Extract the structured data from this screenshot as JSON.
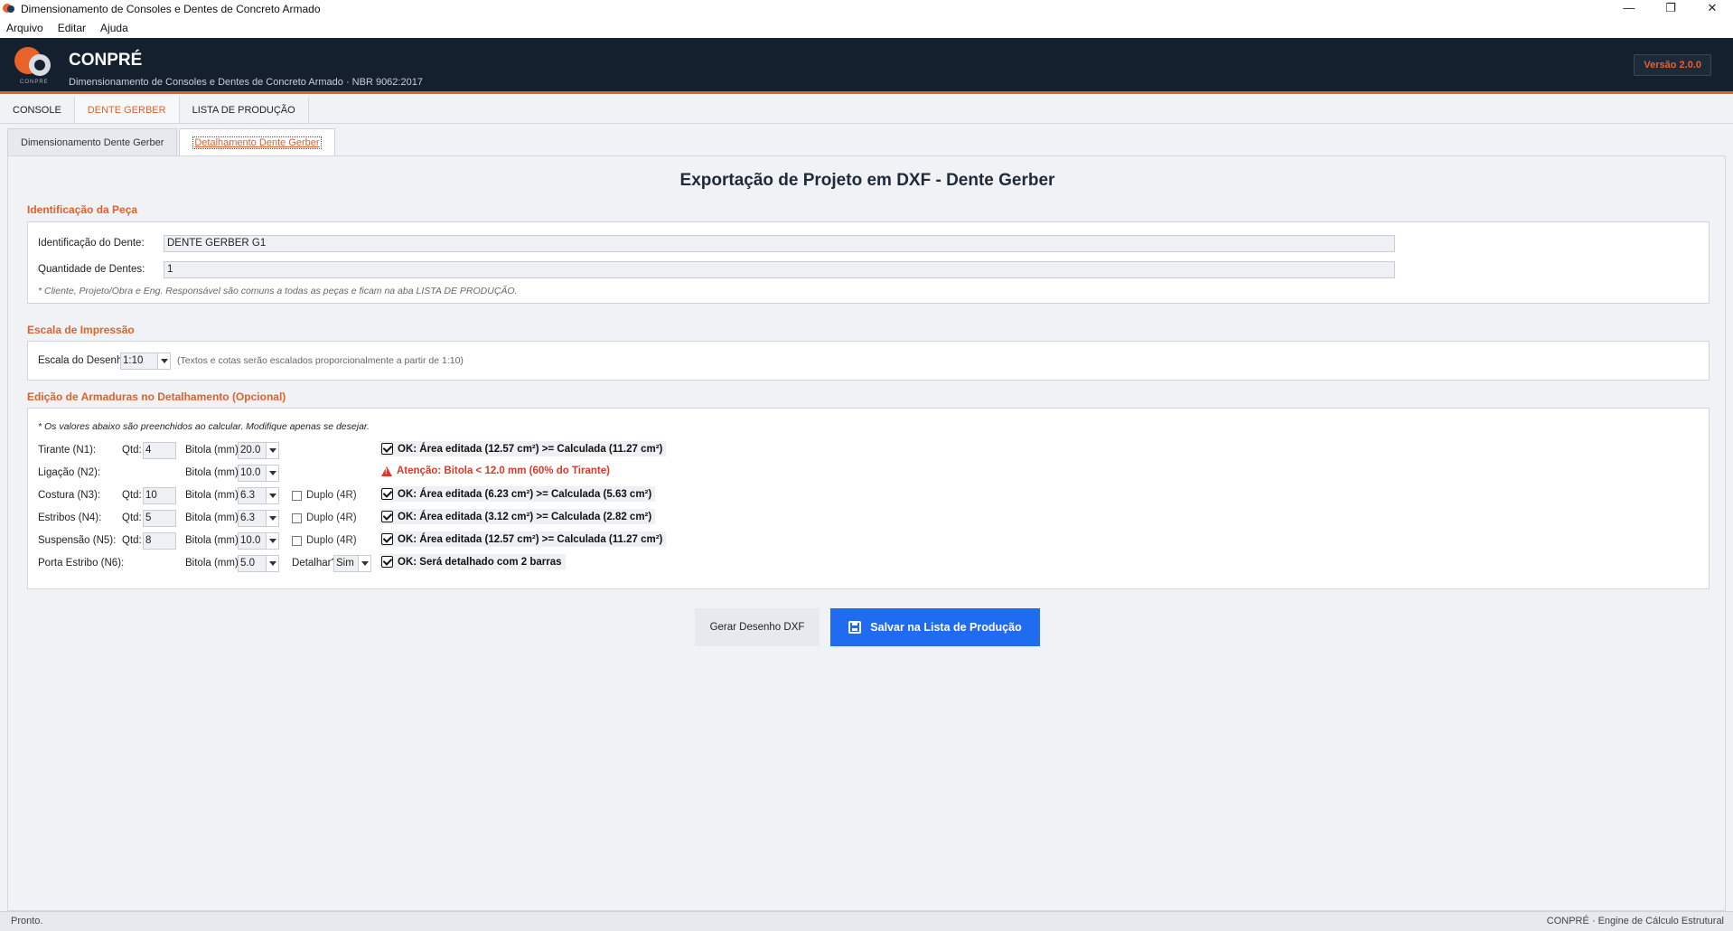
{
  "window": {
    "title": "Dimensionamento de Consoles e Dentes de Concreto Armado",
    "min": "—",
    "max": "❐",
    "close": "✕"
  },
  "menu": [
    "Arquivo",
    "Editar",
    "Ajuda"
  ],
  "header": {
    "logo_text": "CONPRE",
    "brand": "CONPRÉ",
    "subtitle": "Dimensionamento de Consoles e Dentes de Concreto Armado  ·  NBR 9062:2017",
    "version": "Versão 2.0.0"
  },
  "main_tabs": [
    "CONSOLE",
    "DENTE GERBER",
    "LISTA DE PRODUÇÃO"
  ],
  "sub_tabs": [
    "Dimensionamento Dente Gerber",
    "Detalhamento Dente Gerber"
  ],
  "page_title": "Exportação de Projeto em DXF - Dente Gerber",
  "identificacao": {
    "title": "Identificação da Peça",
    "dente_label": "Identificação do Dente:",
    "dente_value": "DENTE GERBER G1",
    "qtd_label": "Quantidade de Dentes:",
    "qtd_value": "1",
    "note": "* Cliente, Projeto/Obra e Eng. Responsável são comuns a todas as peças e ficam na aba LISTA DE PRODUÇÃO."
  },
  "escala": {
    "title": "Escala de Impressão",
    "label": "Escala do Desenho:",
    "value": "1:10",
    "note": "(Textos e cotas serão escalados proporcionalmente a partir de 1:10)"
  },
  "armaduras": {
    "title": "Edição de Armaduras no Detalhamento (Opcional)",
    "note": "* Os valores abaixo são preenchidos ao calcular. Modifique apenas se desejar.",
    "qtd_label": "Qtd:",
    "bitola_label": "Bitola (mm):",
    "duplo_label": "Duplo (4R)",
    "detalhar_label": "Detalhar?",
    "detalhar_value": "Sim",
    "rows": [
      {
        "label": "Tirante (N1):",
        "qtd": "4",
        "bitola": "20.0",
        "status": "OK: Área editada (12.57 cm²) >= Calculada (11.27 cm²)"
      },
      {
        "label": "Ligação (N2):",
        "qtd": "",
        "bitola": "10.0",
        "status": "Atenção: Bitola < 12.0 mm (60% do Tirante)"
      },
      {
        "label": "Costura (N3):",
        "qtd": "10",
        "bitola": "6.3",
        "status": "OK: Área editada (6.23 cm²) >= Calculada (5.63 cm²)"
      },
      {
        "label": "Estribos (N4):",
        "qtd": "5",
        "bitola": "6.3",
        "status": "OK: Área editada (3.12 cm²) >= Calculada (2.82 cm²)"
      },
      {
        "label": "Suspensão (N5):",
        "qtd": "8",
        "bitola": "10.0",
        "status": "OK: Área editada (12.57 cm²) >= Calculada (11.27 cm²)"
      },
      {
        "label": "Porta Estribo (N6):",
        "qtd": "",
        "bitola": "5.0",
        "status": "OK: Será detalhado com 2 barras"
      }
    ]
  },
  "buttons": {
    "gerar": "Gerar Desenho DXF",
    "salvar": "Salvar na Lista de Produção"
  },
  "statusbar": {
    "left": "Pronto.",
    "right": "CONPRÉ  ·  Engine de Cálculo Estrutural"
  }
}
